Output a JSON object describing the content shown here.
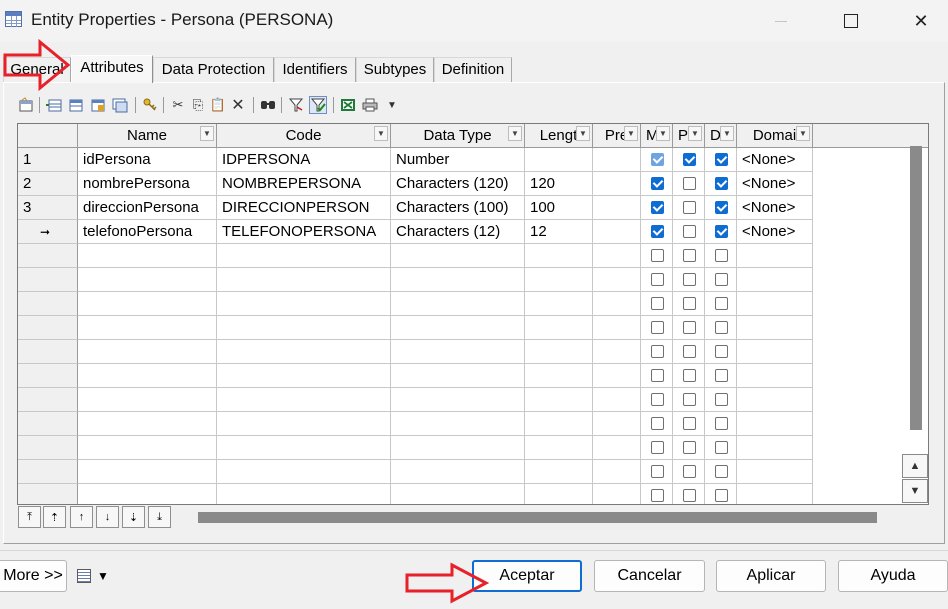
{
  "window": {
    "title": "Entity Properties - Persona (PERSONA)",
    "close_glyph": "✕"
  },
  "tabs": [
    {
      "label": "General",
      "active": false
    },
    {
      "label": "Attributes",
      "active": true
    },
    {
      "label": "Data Protection",
      "active": false
    },
    {
      "label": "Identifiers",
      "active": false
    },
    {
      "label": "Subtypes",
      "active": false
    },
    {
      "label": "Definition",
      "active": false
    }
  ],
  "toolbar": {
    "icons": [
      "properties-icon",
      "insert-row-icon",
      "add-row-icon",
      "add-attributes-icon",
      "reuse-columns-icon",
      "key-icon",
      "cut-icon",
      "copy-icon",
      "paste-icon",
      "delete-icon",
      "find-icon",
      "filter-icon",
      "customize-columns-icon",
      "excel-export-icon",
      "print-icon",
      "more-dropdown-icon"
    ],
    "glyphs": {
      "cut": "✂",
      "copy": "⎘",
      "paste": "📋",
      "delete": "✕",
      "find": "⚲",
      "filter": "Y",
      "dropdown": "▼"
    }
  },
  "grid": {
    "columns": [
      "Name",
      "Code",
      "Data Type",
      "Lengt",
      "Pre",
      "M",
      "P",
      "D",
      "Domai"
    ],
    "rows": [
      {
        "marker": "1",
        "name": "idPersona",
        "code": "IDPERSONA",
        "data_type": "Number",
        "length": "",
        "precision": "",
        "m": true,
        "p": true,
        "d": true,
        "domain": "<None>"
      },
      {
        "marker": "2",
        "name": "nombrePersona",
        "code": "NOMBREPERSONA",
        "data_type": "Characters (120)",
        "length": "120",
        "precision": "",
        "m": true,
        "p": false,
        "d": true,
        "domain": "<None>"
      },
      {
        "marker": "3",
        "name": "direccionPersona",
        "code": "DIRECCIONPERSON",
        "data_type": "Characters (100)",
        "length": "100",
        "precision": "",
        "m": true,
        "p": false,
        "d": true,
        "domain": "<None>"
      },
      {
        "marker": "➞",
        "name": "telefonoPersona",
        "code": "TELEFONOPERSONA",
        "data_type": "Characters (12)",
        "length": "12",
        "precision": "",
        "m": true,
        "p": false,
        "d": true,
        "domain": "<None>"
      }
    ],
    "empty_row_count": 11
  },
  "navigation": {
    "buttons": [
      "⤒",
      "⇡",
      "↑",
      "↓",
      "⇣",
      "⤓"
    ]
  },
  "vscroll": {
    "up_glyph": "▲",
    "down_glyph": "▼"
  },
  "footer": {
    "more_label": "More >>",
    "dropdown_glyph": "▼",
    "buttons": [
      {
        "label": "Aceptar",
        "default": true
      },
      {
        "label": "Cancelar",
        "default": false
      },
      {
        "label": "Aplicar",
        "default": false
      },
      {
        "label": "Ayuda",
        "default": false
      }
    ]
  },
  "annotations": {
    "arrow_color": "#e8202a"
  }
}
